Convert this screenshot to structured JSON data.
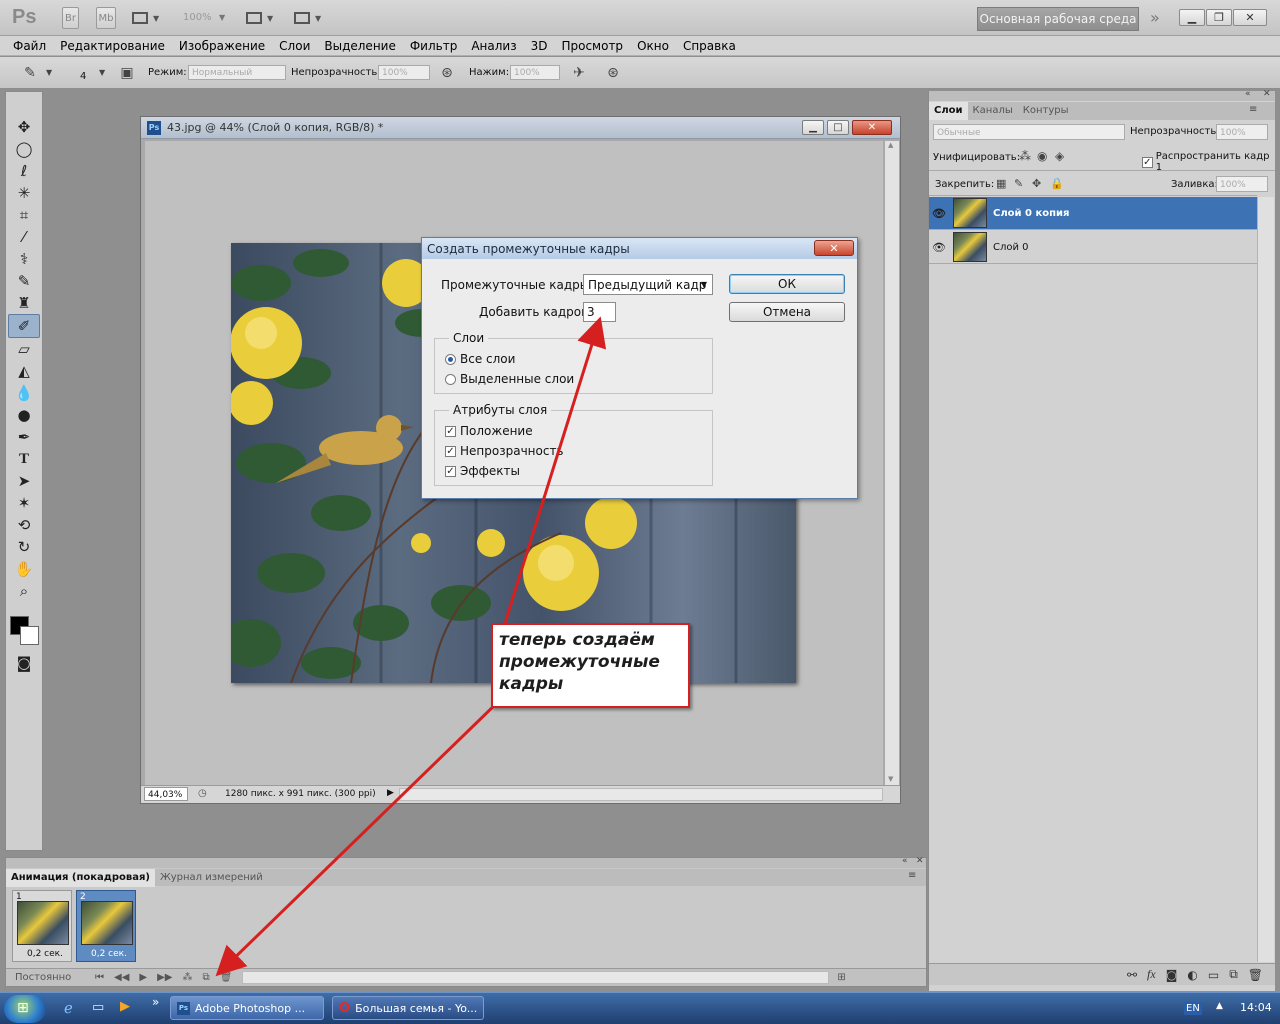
{
  "app": {
    "logo": "Ps",
    "bridge_label": "Br",
    "minibridge_label": "Mb",
    "zoom": "100%",
    "workspace": "Основная рабочая среда",
    "more": "»"
  },
  "menu": [
    "Файл",
    "Редактирование",
    "Изображение",
    "Слои",
    "Выделение",
    "Фильтр",
    "Анализ",
    "3D",
    "Просмотр",
    "Окно",
    "Справка"
  ],
  "options": {
    "brush_size": "4",
    "mode_label": "Режим:",
    "mode_value": "Нормальный",
    "opacity_label": "Непрозрачность:",
    "opacity_value": "100%",
    "pressure_label": "Нажим:",
    "pressure_value": "100%"
  },
  "document": {
    "title": "43.jpg @ 44% (Слой 0 копия, RGB/8) *",
    "zoom": "44,03%",
    "info": "1280 пикс. x 991 пикс. (300 ppi)"
  },
  "dialog": {
    "title": "Создать промежуточные кадры",
    "tween_label": "Промежуточные кадры:",
    "tween_value": "Предыдущий кадр",
    "add_label": "Добавить кадров:",
    "add_value": "3",
    "ok": "ОК",
    "cancel": "Отмена",
    "layers_group": "Слои",
    "all_layers": "Все слои",
    "selected_layers": "Выделенные слои",
    "attrs_group": "Атрибуты слоя",
    "position": "Положение",
    "opacity": "Непрозрачность",
    "effects": "Эффекты"
  },
  "layers_panel": {
    "tabs": [
      "Слои",
      "Каналы",
      "Контуры"
    ],
    "blend_mode": "Обычные",
    "opacity_label": "Непрозрачность:",
    "opacity_value": "100%",
    "unify_label": "Унифицировать:",
    "propagate_label": "Распространить кадр 1",
    "lock_label": "Закрепить:",
    "fill_label": "Заливка:",
    "fill_value": "100%",
    "layers": [
      {
        "name": "Слой 0 копия",
        "selected": true
      },
      {
        "name": "Слой 0",
        "selected": false
      }
    ]
  },
  "animation_panel": {
    "tabs": [
      "Анимация (покадровая)",
      "Журнал измерений"
    ],
    "frames": [
      {
        "number": "1",
        "delay": "0,2 сек."
      },
      {
        "number": "2",
        "delay": "0,2 сек."
      }
    ],
    "loop": "Постоянно"
  },
  "annotation": "теперь создаём промежуточные кадры",
  "taskbar": {
    "tasks": [
      "Adobe Photoshop ...",
      "Большая семья - Yo..."
    ],
    "lang": "EN",
    "time": "14:04"
  },
  "colors": {
    "accent_selected": "#3d73b4",
    "annotation_border": "#d62020"
  }
}
